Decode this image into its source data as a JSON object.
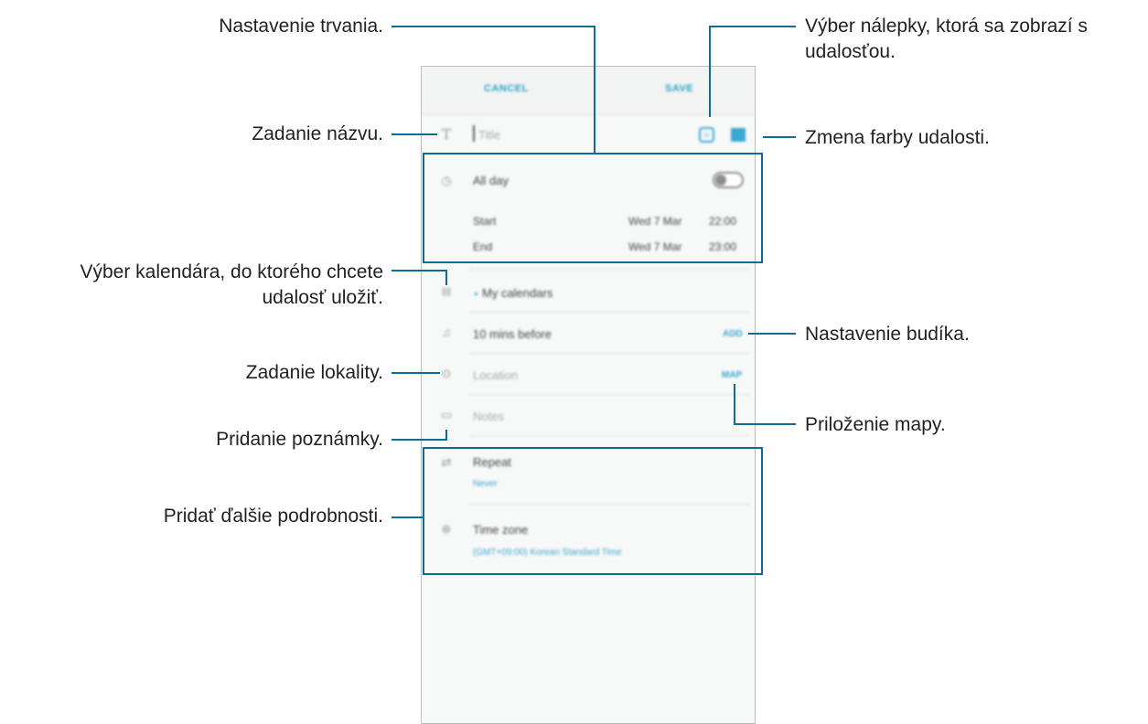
{
  "callouts": {
    "duration": "Nastavenie trvania.",
    "title": "Zadanie názvu.",
    "calendar_line1": "Výber kalendára, do ktorého chcete",
    "calendar_line2": "udalosť uložiť.",
    "location": "Zadanie lokality.",
    "notes": "Pridanie poznámky.",
    "details": "Pridať ďalšie podrobnosti.",
    "sticker_line1": "Výber nálepky, ktorá sa zobrazí s",
    "sticker_line2": "udalosťou.",
    "color": "Zmena farby udalosti.",
    "alarm": "Nastavenie budíka.",
    "map": "Priloženie mapy."
  },
  "screen": {
    "cancel": "CANCEL",
    "save": "SAVE",
    "title_placeholder": "Title",
    "all_day": "All day",
    "all_day_on": false,
    "start_label": "Start",
    "start_date": "Wed 7 Mar",
    "start_time": "22:00",
    "end_label": "End",
    "end_date": "Wed 7 Mar",
    "end_time": "23:00",
    "calendar": "My calendars",
    "reminder": "10 mins before",
    "add": "ADD",
    "location_placeholder": "Location",
    "map": "MAP",
    "notes_placeholder": "Notes",
    "repeat": "Repeat",
    "repeat_value": "Never",
    "timezone": "Time zone",
    "timezone_value": "(GMT+09:00) Korean Standard Time"
  },
  "colors": {
    "accent": "#3ba8cf",
    "callout_line": "#0f6d94"
  },
  "icons": [
    "text-icon",
    "clock-icon",
    "calendar-icon",
    "bell-icon",
    "location-pin-icon",
    "notes-icon",
    "repeat-icon",
    "globe-icon",
    "sticker-icon"
  ]
}
